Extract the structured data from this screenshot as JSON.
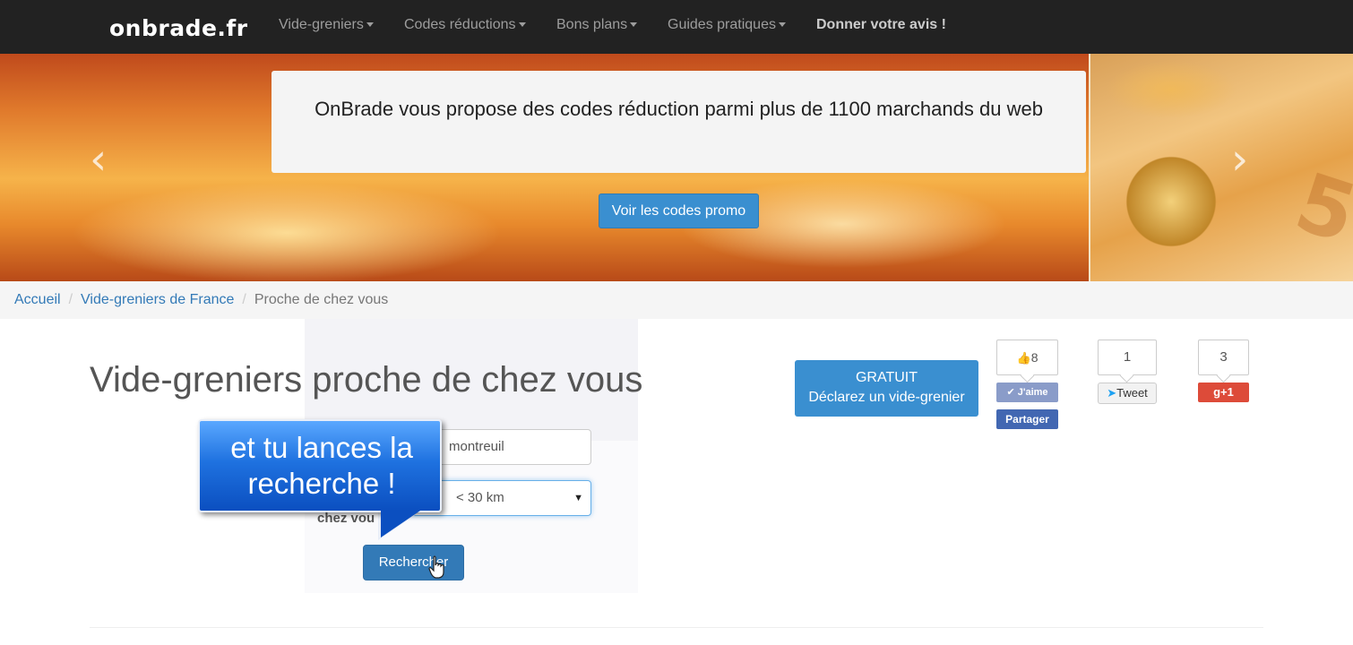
{
  "navbar": {
    "brand": "onbrade.fr",
    "items": [
      {
        "label": "Vide-greniers",
        "has_caret": true
      },
      {
        "label": "Codes réductions",
        "has_caret": true
      },
      {
        "label": "Bons plans",
        "has_caret": true
      },
      {
        "label": "Guides pratiques",
        "has_caret": true
      },
      {
        "label": "Donner votre avis !",
        "has_caret": false
      }
    ]
  },
  "hero": {
    "text": "OnBrade vous propose des codes réduction parmi plus de 1100 marchands du web",
    "button_label": "Voir les codes promo",
    "prev_icon": "chevron-left-icon",
    "next_icon": "chevron-right-icon"
  },
  "breadcrumb": {
    "items": [
      "Accueil",
      "Vide-greniers de France"
    ],
    "current": "Proche de chez vous"
  },
  "main": {
    "title": "Vide-greniers proche de chez vous",
    "city_value": "montreuil",
    "distance_value": "< 30 km",
    "label_partial": "chez vou",
    "search_button": "Rechercher"
  },
  "callout": {
    "line1": "et tu lances la",
    "line2": "recherche !"
  },
  "declare": {
    "line1": "GRATUIT",
    "line2": "Déclarez un vide-grenier"
  },
  "social": {
    "facebook_count": "8",
    "facebook_like": "J'aime",
    "facebook_share": "Partager",
    "twitter_count": "1",
    "twitter_label": "Tweet",
    "gplus_count": "3",
    "gplus_label": "g+1"
  },
  "colors": {
    "navbar_bg": "#222222",
    "primary": "#337ab7",
    "facebook": "#4267b2",
    "gplus": "#dd4b39"
  }
}
